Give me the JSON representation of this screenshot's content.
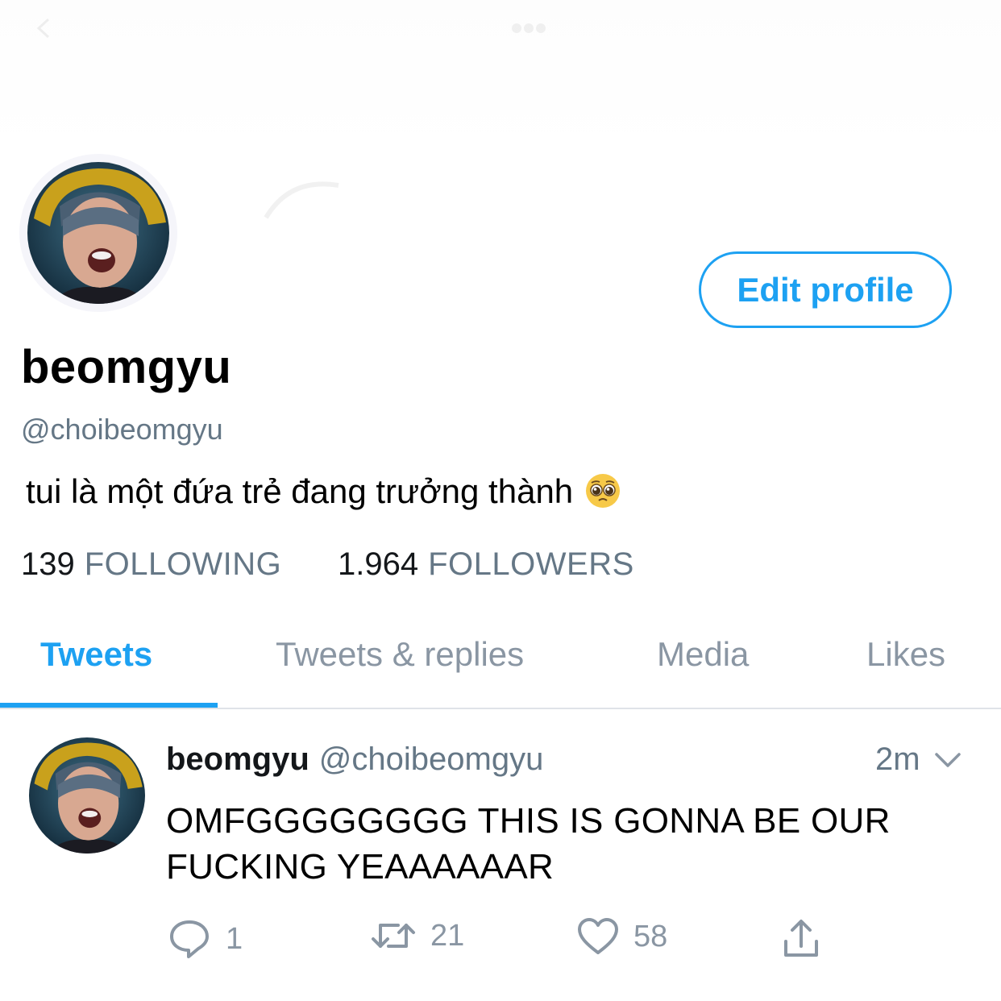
{
  "profile": {
    "display_name": "beomgyu",
    "handle": "@choibeomgyu",
    "bio": "tui là một đứa trẻ đang trưởng thành",
    "bio_emoji": "pleading-face",
    "edit_profile_label": "Edit profile",
    "following_count": "139",
    "following_label": "FOLLOWING",
    "followers_count": "1.964",
    "followers_label": "FOLLOWERS"
  },
  "tabs": [
    {
      "label": "Tweets",
      "active": true
    },
    {
      "label": "Tweets & replies",
      "active": false
    },
    {
      "label": "Media",
      "active": false
    },
    {
      "label": "Likes",
      "active": false
    }
  ],
  "tweet": {
    "name": "beomgyu",
    "handle": "@choibeomgyu",
    "time": "2m",
    "text": "OMFGGGGGGGG THIS IS GONNA BE OUR FUCKING YEAAAAAAR",
    "replies": "1",
    "retweets": "21",
    "likes": "58",
    "icons": {
      "reply": "reply-icon",
      "retweet": "retweet-icon",
      "like": "heart-icon",
      "share": "share-icon",
      "menu": "chevron-down-icon"
    }
  },
  "colors": {
    "accent": "#1da1f2",
    "secondary_text": "#657786",
    "action_gray": "#8a96a3",
    "divider": "#dfe3e8"
  }
}
